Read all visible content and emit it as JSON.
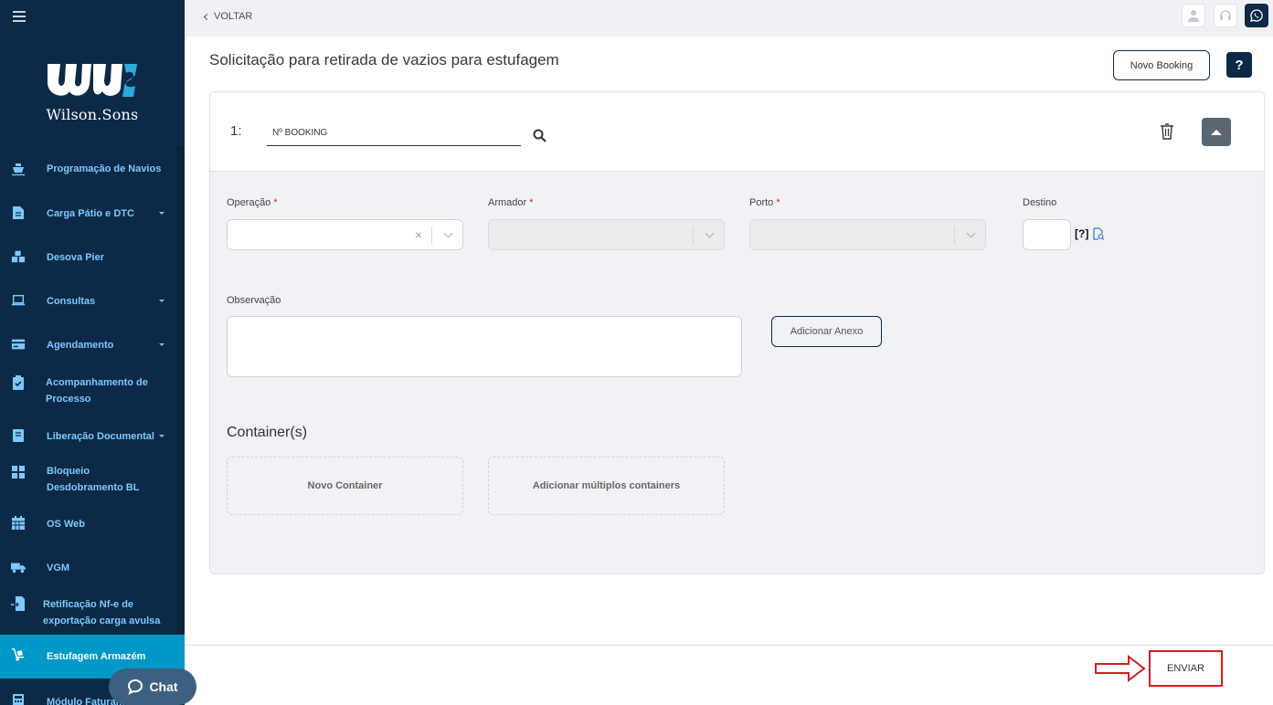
{
  "brand": {
    "name": "Wilson.Sons",
    "primary": "#0c2a47",
    "accent": "#0099c7",
    "danger": "#d21f1f"
  },
  "sidebar": {
    "items": [
      {
        "label": "Programação de Navios",
        "icon": "ship-icon",
        "submenu": false
      },
      {
        "label": "Carga Pátio e DTC",
        "icon": "document-icon",
        "submenu": true
      },
      {
        "label": "Desova Pier",
        "icon": "boxes-icon",
        "submenu": false
      },
      {
        "label": "Consultas",
        "icon": "laptop-icon",
        "submenu": true
      },
      {
        "label": "Agendamento",
        "icon": "card-icon",
        "submenu": true
      },
      {
        "label": "Acompanhamento de Processo",
        "icon": "clipboard-check-icon",
        "submenu": false
      },
      {
        "label": "Liberação Documental",
        "icon": "book-icon",
        "submenu": true
      },
      {
        "label": "Bloqueio Desdobramento BL",
        "icon": "grid-icon",
        "submenu": false
      },
      {
        "label": "OS Web",
        "icon": "calendar-icon",
        "submenu": false
      },
      {
        "label": "VGM",
        "icon": "truck-icon",
        "submenu": false
      },
      {
        "label": "Retificação Nf-e de exportação carga avulsa",
        "icon": "file-import-icon",
        "submenu": false
      },
      {
        "label": "Estufagem Armazém",
        "icon": "hand-truck-icon",
        "submenu": false,
        "active": true
      },
      {
        "label": "Módulo Faturamento",
        "icon": "calculator-icon",
        "submenu": false
      }
    ]
  },
  "chat": {
    "label": "Chat"
  },
  "topbar": {
    "back_label": "VOLTAR"
  },
  "page": {
    "title": "Solicitação para retirada de vazios para estufagem",
    "new_booking_label": "Novo Booking",
    "help_label": "?"
  },
  "booking": {
    "index_label": "1:",
    "booking_placeholder": "Nº BOOKING"
  },
  "form": {
    "operacao_label": "Operação",
    "armador_label": "Armador",
    "porto_label": "Porto",
    "destino_label": "Destino",
    "required_mark": "*",
    "clear_symbol": "×",
    "destino_help": "[?]",
    "observacao_label": "Observação",
    "anexo_label": "Adicionar Anexo"
  },
  "containers": {
    "section_title": "Container(s)",
    "new_label": "Novo Container",
    "multiple_label": "Adicionar múltiplos containers"
  },
  "footer": {
    "submit_label": "ENVIAR"
  }
}
